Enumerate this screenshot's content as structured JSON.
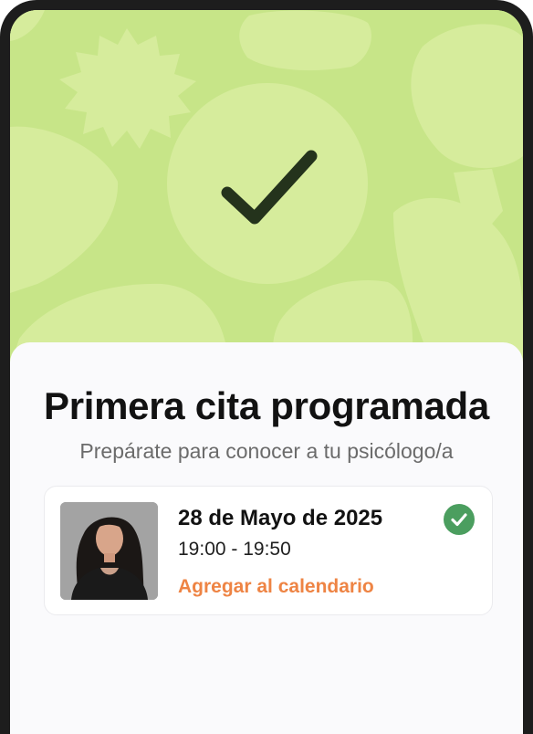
{
  "confirmation": {
    "title": "Primera cita programada",
    "subtitle": "Prepárate para conocer a tu psicólogo/a"
  },
  "appointment": {
    "date": "28 de Mayo de 2025",
    "time": "19:00 - 19:50",
    "add_to_calendar": "Agregar al calendario",
    "status_icon": "check-circle-icon"
  },
  "colors": {
    "hero_background": "#c7e588",
    "hero_shapes": "#d6ec9c",
    "check_stroke": "#24331c",
    "accent_link": "#ee8444",
    "success_badge": "#4b9e5f"
  }
}
